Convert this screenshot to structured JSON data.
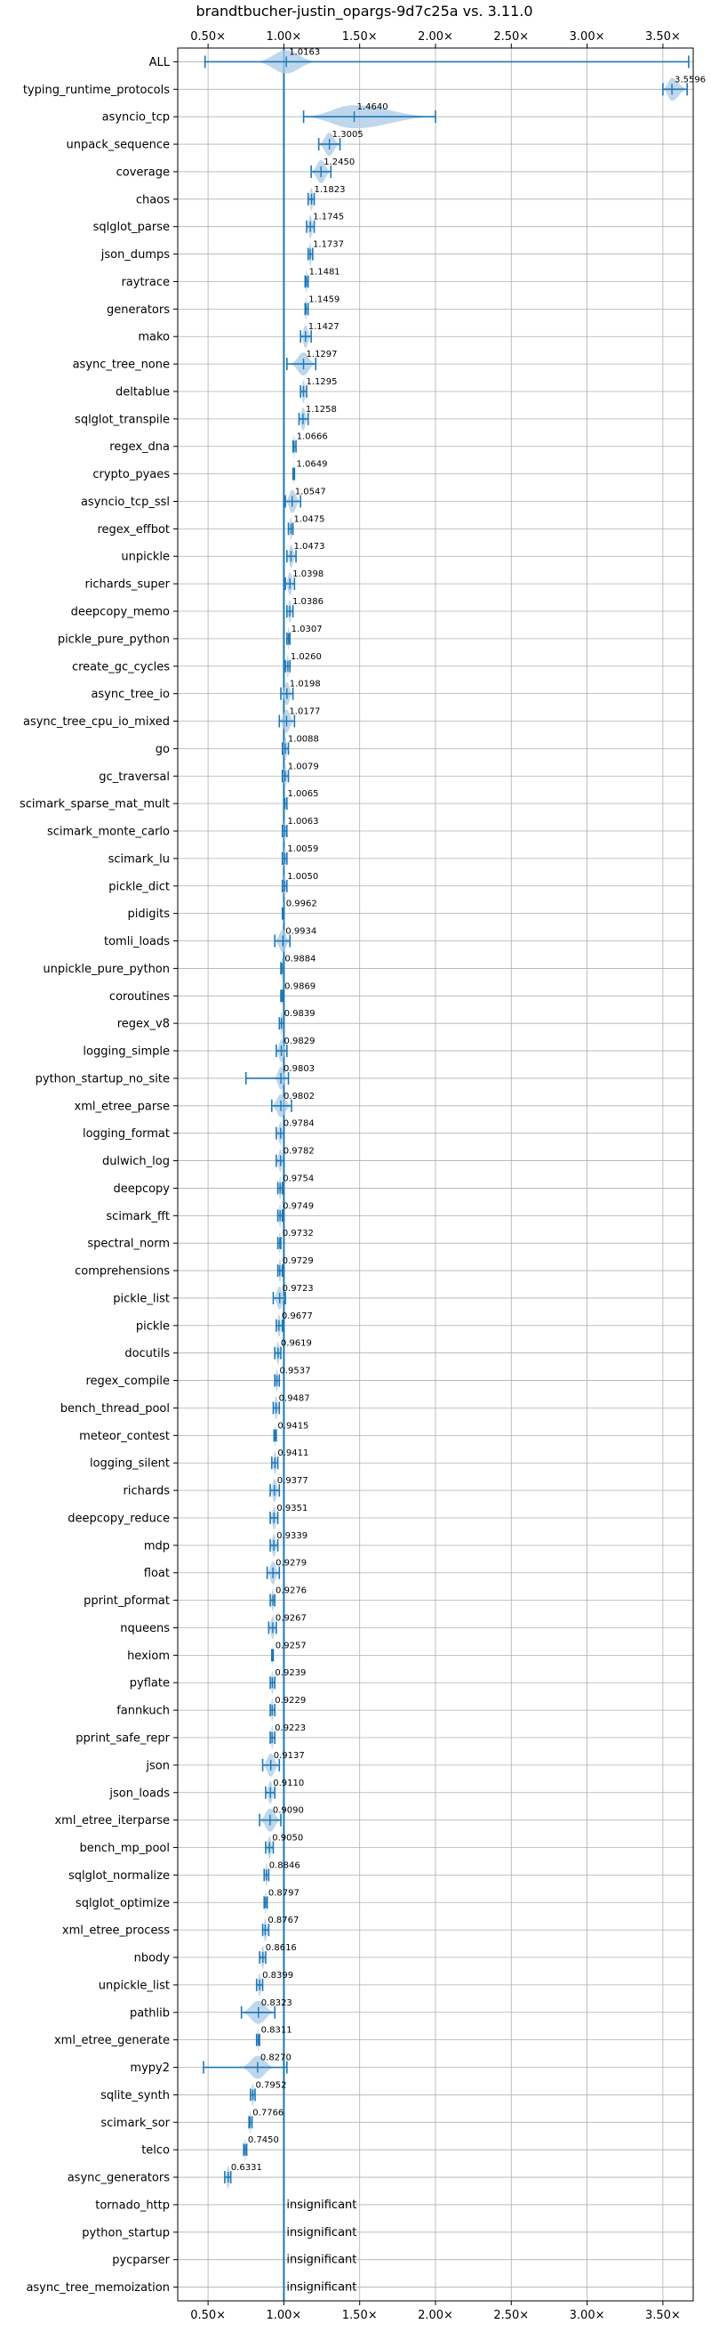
{
  "chart_data": {
    "type": "violin",
    "title": "brandtbucher-justin_opargs-9d7c25a vs. 3.11.0",
    "xlim": [
      0.3,
      3.7
    ],
    "xticks": [
      0.5,
      1.0,
      1.5,
      2.0,
      2.5,
      3.0,
      3.5
    ],
    "xtick_labels": [
      "0.50×",
      "1.00×",
      "1.50×",
      "2.00×",
      "2.50×",
      "3.00×",
      "3.50×"
    ],
    "reference_line": 1.0,
    "grid": true,
    "colors": {
      "accent": "#1f77b4",
      "violin": "#a9c9e6",
      "grid": "#b0b0b0"
    },
    "insignificant_text": "insignificant",
    "rows": [
      {
        "name": "ALL",
        "label": "1.0163",
        "value": 1.0163,
        "min": 0.48,
        "max": 3.67,
        "spread": 0.09
      },
      {
        "name": "typing_runtime_protocols",
        "label": "3.5596",
        "value": 3.5596,
        "min": 3.5,
        "max": 3.66,
        "spread": 0.06
      },
      {
        "name": "asyncio_tcp",
        "label": "1.4640",
        "value": 1.464,
        "min": 1.13,
        "max": 2.0,
        "spread": 0.28
      },
      {
        "name": "unpack_sequence",
        "label": "1.3005",
        "value": 1.3005,
        "min": 1.23,
        "max": 1.37,
        "spread": 0.06
      },
      {
        "name": "coverage",
        "label": "1.2450",
        "value": 1.245,
        "min": 1.18,
        "max": 1.31,
        "spread": 0.06
      },
      {
        "name": "chaos",
        "label": "1.1823",
        "value": 1.1823,
        "min": 1.16,
        "max": 1.2,
        "spread": 0.02
      },
      {
        "name": "sqlglot_parse",
        "label": "1.1745",
        "value": 1.1745,
        "min": 1.15,
        "max": 1.2,
        "spread": 0.025
      },
      {
        "name": "json_dumps",
        "label": "1.1737",
        "value": 1.1737,
        "min": 1.16,
        "max": 1.19,
        "spread": 0.015
      },
      {
        "name": "raytrace",
        "label": "1.1481",
        "value": 1.1481,
        "min": 1.14,
        "max": 1.16,
        "spread": 0.01
      },
      {
        "name": "generators",
        "label": "1.1459",
        "value": 1.1459,
        "min": 1.14,
        "max": 1.16,
        "spread": 0.01
      },
      {
        "name": "mako",
        "label": "1.1427",
        "value": 1.1427,
        "min": 1.11,
        "max": 1.18,
        "spread": 0.03
      },
      {
        "name": "async_tree_none",
        "label": "1.1297",
        "value": 1.1297,
        "min": 1.02,
        "max": 1.21,
        "spread": 0.04
      },
      {
        "name": "deltablue",
        "label": "1.1295",
        "value": 1.1295,
        "min": 1.11,
        "max": 1.15,
        "spread": 0.02
      },
      {
        "name": "sqlglot_transpile",
        "label": "1.1258",
        "value": 1.1258,
        "min": 1.1,
        "max": 1.16,
        "spread": 0.03
      },
      {
        "name": "regex_dna",
        "label": "1.0666",
        "value": 1.0666,
        "min": 1.06,
        "max": 1.08,
        "spread": 0.01
      },
      {
        "name": "crypto_pyaes",
        "label": "1.0649",
        "value": 1.0649,
        "min": 1.06,
        "max": 1.07,
        "spread": 0.008
      },
      {
        "name": "asyncio_tcp_ssl",
        "label": "1.0547",
        "value": 1.0547,
        "min": 1.01,
        "max": 1.11,
        "spread": 0.03
      },
      {
        "name": "regex_effbot",
        "label": "1.0475",
        "value": 1.0475,
        "min": 1.03,
        "max": 1.06,
        "spread": 0.015
      },
      {
        "name": "unpickle",
        "label": "1.0473",
        "value": 1.0473,
        "min": 1.02,
        "max": 1.08,
        "spread": 0.03
      },
      {
        "name": "richards_super",
        "label": "1.0398",
        "value": 1.0398,
        "min": 1.01,
        "max": 1.07,
        "spread": 0.03
      },
      {
        "name": "deepcopy_memo",
        "label": "1.0386",
        "value": 1.0386,
        "min": 1.02,
        "max": 1.06,
        "spread": 0.02
      },
      {
        "name": "pickle_pure_python",
        "label": "1.0307",
        "value": 1.0307,
        "min": 1.02,
        "max": 1.04,
        "spread": 0.01
      },
      {
        "name": "create_gc_cycles",
        "label": "1.0260",
        "value": 1.026,
        "min": 1.01,
        "max": 1.04,
        "spread": 0.015
      },
      {
        "name": "async_tree_io",
        "label": "1.0198",
        "value": 1.0198,
        "min": 0.98,
        "max": 1.06,
        "spread": 0.03
      },
      {
        "name": "async_tree_cpu_io_mixed",
        "label": "1.0177",
        "value": 1.0177,
        "min": 0.97,
        "max": 1.07,
        "spread": 0.04
      },
      {
        "name": "go",
        "label": "1.0088",
        "value": 1.0088,
        "min": 0.99,
        "max": 1.03,
        "spread": 0.02
      },
      {
        "name": "gc_traversal",
        "label": "1.0079",
        "value": 1.0079,
        "min": 0.99,
        "max": 1.03,
        "spread": 0.02
      },
      {
        "name": "scimark_sparse_mat_mult",
        "label": "1.0065",
        "value": 1.0065,
        "min": 1.0,
        "max": 1.02,
        "spread": 0.01
      },
      {
        "name": "scimark_monte_carlo",
        "label": "1.0063",
        "value": 1.0063,
        "min": 0.99,
        "max": 1.02,
        "spread": 0.01
      },
      {
        "name": "scimark_lu",
        "label": "1.0059",
        "value": 1.0059,
        "min": 0.99,
        "max": 1.02,
        "spread": 0.01
      },
      {
        "name": "pickle_dict",
        "label": "1.0050",
        "value": 1.005,
        "min": 0.99,
        "max": 1.02,
        "spread": 0.01
      },
      {
        "name": "pidigits",
        "label": "0.9962",
        "value": 0.9962,
        "min": 0.99,
        "max": 1.0,
        "spread": 0.004
      },
      {
        "name": "tomli_loads",
        "label": "0.9934",
        "value": 0.9934,
        "min": 0.94,
        "max": 1.04,
        "spread": 0.04
      },
      {
        "name": "unpickle_pure_python",
        "label": "0.9884",
        "value": 0.9884,
        "min": 0.98,
        "max": 1.0,
        "spread": 0.008
      },
      {
        "name": "coroutines",
        "label": "0.9869",
        "value": 0.9869,
        "min": 0.98,
        "max": 0.99,
        "spread": 0.006
      },
      {
        "name": "regex_v8",
        "label": "0.9839",
        "value": 0.9839,
        "min": 0.97,
        "max": 1.0,
        "spread": 0.01
      },
      {
        "name": "logging_simple",
        "label": "0.9829",
        "value": 0.9829,
        "min": 0.95,
        "max": 1.02,
        "spread": 0.03
      },
      {
        "name": "python_startup_no_site",
        "label": "0.9803",
        "value": 0.9803,
        "min": 0.75,
        "max": 1.03,
        "spread": 0.02
      },
      {
        "name": "xml_etree_parse",
        "label": "0.9802",
        "value": 0.9802,
        "min": 0.92,
        "max": 1.05,
        "spread": 0.05
      },
      {
        "name": "logging_format",
        "label": "0.9784",
        "value": 0.9784,
        "min": 0.95,
        "max": 1.0,
        "spread": 0.02
      },
      {
        "name": "dulwich_log",
        "label": "0.9782",
        "value": 0.9782,
        "min": 0.95,
        "max": 1.0,
        "spread": 0.02
      },
      {
        "name": "deepcopy",
        "label": "0.9754",
        "value": 0.9754,
        "min": 0.96,
        "max": 0.99,
        "spread": 0.015
      },
      {
        "name": "scimark_fft",
        "label": "0.9749",
        "value": 0.9749,
        "min": 0.96,
        "max": 0.99,
        "spread": 0.01
      },
      {
        "name": "spectral_norm",
        "label": "0.9732",
        "value": 0.9732,
        "min": 0.96,
        "max": 0.98,
        "spread": 0.01
      },
      {
        "name": "comprehensions",
        "label": "0.9729",
        "value": 0.9729,
        "min": 0.96,
        "max": 0.99,
        "spread": 0.01
      },
      {
        "name": "pickle_list",
        "label": "0.9723",
        "value": 0.9723,
        "min": 0.93,
        "max": 1.01,
        "spread": 0.03
      },
      {
        "name": "pickle",
        "label": "0.9677",
        "value": 0.9677,
        "min": 0.95,
        "max": 0.99,
        "spread": 0.015
      },
      {
        "name": "docutils",
        "label": "0.9619",
        "value": 0.9619,
        "min": 0.94,
        "max": 0.98,
        "spread": 0.015
      },
      {
        "name": "regex_compile",
        "label": "0.9537",
        "value": 0.9537,
        "min": 0.94,
        "max": 0.97,
        "spread": 0.01
      },
      {
        "name": "bench_thread_pool",
        "label": "0.9487",
        "value": 0.9487,
        "min": 0.93,
        "max": 0.97,
        "spread": 0.015
      },
      {
        "name": "meteor_contest",
        "label": "0.9415",
        "value": 0.9415,
        "min": 0.935,
        "max": 0.95,
        "spread": 0.006
      },
      {
        "name": "logging_silent",
        "label": "0.9411",
        "value": 0.9411,
        "min": 0.92,
        "max": 0.96,
        "spread": 0.015
      },
      {
        "name": "richards",
        "label": "0.9377",
        "value": 0.9377,
        "min": 0.91,
        "max": 0.97,
        "spread": 0.02
      },
      {
        "name": "deepcopy_reduce",
        "label": "0.9351",
        "value": 0.9351,
        "min": 0.91,
        "max": 0.96,
        "spread": 0.02
      },
      {
        "name": "mdp",
        "label": "0.9339",
        "value": 0.9339,
        "min": 0.91,
        "max": 0.96,
        "spread": 0.02
      },
      {
        "name": "float",
        "label": "0.9279",
        "value": 0.9279,
        "min": 0.89,
        "max": 0.97,
        "spread": 0.03
      },
      {
        "name": "pprint_pformat",
        "label": "0.9276",
        "value": 0.9276,
        "min": 0.91,
        "max": 0.94,
        "spread": 0.01
      },
      {
        "name": "nqueens",
        "label": "0.9267",
        "value": 0.9267,
        "min": 0.9,
        "max": 0.95,
        "spread": 0.015
      },
      {
        "name": "hexiom",
        "label": "0.9257",
        "value": 0.9257,
        "min": 0.92,
        "max": 0.93,
        "spread": 0.005
      },
      {
        "name": "pyflate",
        "label": "0.9239",
        "value": 0.9239,
        "min": 0.91,
        "max": 0.94,
        "spread": 0.01
      },
      {
        "name": "fannkuch",
        "label": "0.9229",
        "value": 0.9229,
        "min": 0.91,
        "max": 0.94,
        "spread": 0.01
      },
      {
        "name": "pprint_safe_repr",
        "label": "0.9223",
        "value": 0.9223,
        "min": 0.91,
        "max": 0.94,
        "spread": 0.01
      },
      {
        "name": "json",
        "label": "0.9137",
        "value": 0.9137,
        "min": 0.86,
        "max": 0.97,
        "spread": 0.04
      },
      {
        "name": "json_loads",
        "label": "0.9110",
        "value": 0.911,
        "min": 0.88,
        "max": 0.94,
        "spread": 0.02
      },
      {
        "name": "xml_etree_iterparse",
        "label": "0.9090",
        "value": 0.909,
        "min": 0.84,
        "max": 0.98,
        "spread": 0.05
      },
      {
        "name": "bench_mp_pool",
        "label": "0.9050",
        "value": 0.905,
        "min": 0.88,
        "max": 0.93,
        "spread": 0.015
      },
      {
        "name": "sqlglot_normalize",
        "label": "0.8846",
        "value": 0.8846,
        "min": 0.87,
        "max": 0.9,
        "spread": 0.01
      },
      {
        "name": "sqlglot_optimize",
        "label": "0.8797",
        "value": 0.8797,
        "min": 0.87,
        "max": 0.89,
        "spread": 0.008
      },
      {
        "name": "xml_etree_process",
        "label": "0.8767",
        "value": 0.8767,
        "min": 0.86,
        "max": 0.9,
        "spread": 0.015
      },
      {
        "name": "nbody",
        "label": "0.8616",
        "value": 0.8616,
        "min": 0.84,
        "max": 0.88,
        "spread": 0.015
      },
      {
        "name": "unpickle_list",
        "label": "0.8399",
        "value": 0.8399,
        "min": 0.82,
        "max": 0.86,
        "spread": 0.015
      },
      {
        "name": "pathlib",
        "label": "0.8323",
        "value": 0.8323,
        "min": 0.72,
        "max": 0.94,
        "spread": 0.06
      },
      {
        "name": "xml_etree_generate",
        "label": "0.8311",
        "value": 0.8311,
        "min": 0.82,
        "max": 0.84,
        "spread": 0.008
      },
      {
        "name": "mypy2",
        "label": "0.8270",
        "value": 0.827,
        "min": 0.47,
        "max": 1.02,
        "spread": 0.05
      },
      {
        "name": "sqlite_synth",
        "label": "0.7952",
        "value": 0.7952,
        "min": 0.78,
        "max": 0.81,
        "spread": 0.01
      },
      {
        "name": "scimark_sor",
        "label": "0.7766",
        "value": 0.7766,
        "min": 0.77,
        "max": 0.79,
        "spread": 0.006
      },
      {
        "name": "telco",
        "label": "0.7450",
        "value": 0.745,
        "min": 0.735,
        "max": 0.755,
        "spread": 0.006
      },
      {
        "name": "async_generators",
        "label": "0.6331",
        "value": 0.6331,
        "min": 0.61,
        "max": 0.65,
        "spread": 0.015
      },
      {
        "name": "tornado_http",
        "label": "insignificant",
        "value": null
      },
      {
        "name": "python_startup",
        "label": "insignificant",
        "value": null
      },
      {
        "name": "pycparser",
        "label": "insignificant",
        "value": null
      },
      {
        "name": "async_tree_memoization",
        "label": "insignificant",
        "value": null
      }
    ]
  }
}
